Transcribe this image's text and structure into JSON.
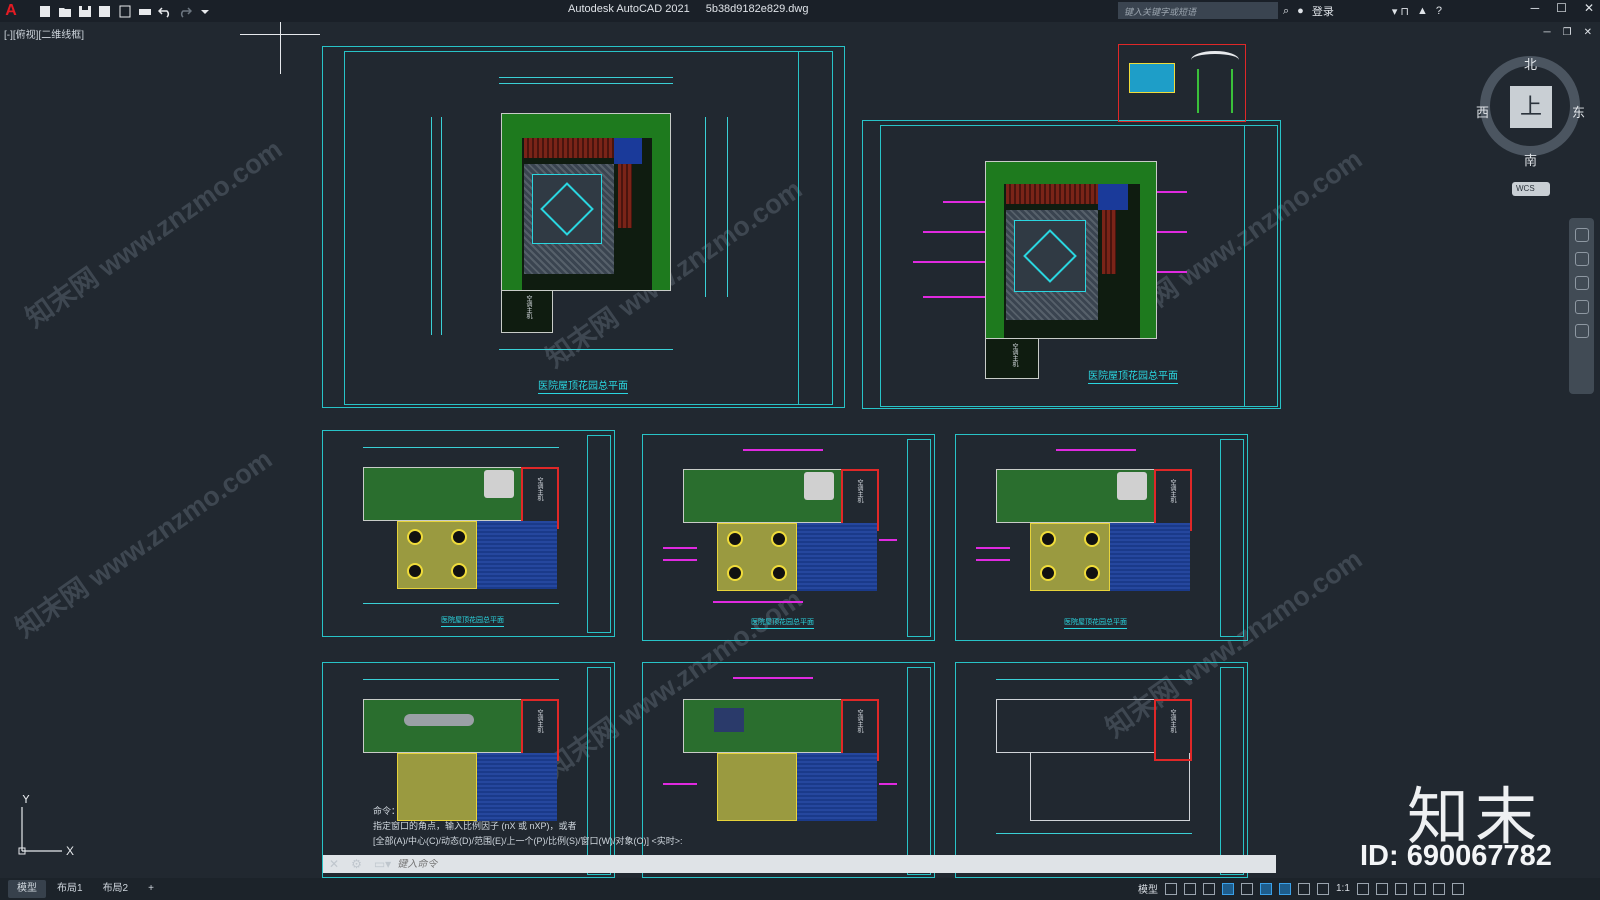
{
  "app": {
    "title": "Autodesk AutoCAD 2021",
    "file": "5b38d9182e829.dwg",
    "search_placeholder": "键入关键字或短语",
    "login_label": "登录",
    "view_label": "[-][俯视][二维线框]"
  },
  "compass": {
    "north": "北",
    "south": "南",
    "east": "东",
    "west": "西",
    "face": "上",
    "wcs": "WCS"
  },
  "sheets": {
    "s1_title": "医院屋顶花园总平面",
    "s2_title": "医院屋顶花园总平面",
    "small_title": "医院屋顶花园总平面",
    "equip_label": "空调主机"
  },
  "command": {
    "history_label": "命令：",
    "line1": "指定窗口的角点，输入比例因子 (nX 或 nXP)，或者",
    "line2": "[全部(A)/中心(C)/动态(D)/范围(E)/上一个(P)/比例(S)/窗口(W)/对象(O)] <实时>:",
    "input_placeholder": "键入命令"
  },
  "layout_tabs": [
    {
      "label": "模型",
      "active": true
    },
    {
      "label": "布局1",
      "active": false
    },
    {
      "label": "布局2",
      "active": false
    }
  ],
  "status": {
    "model_label": "模型",
    "scale": "1:1"
  },
  "watermark": {
    "site": "知末网 www.znzmo.com",
    "brand": "知末",
    "id_label": "ID: 690067782"
  },
  "colors": {
    "accent_cyan": "#28c3c7",
    "magenta": "#e02ae0",
    "red": "#e02828",
    "background": "#212830"
  }
}
